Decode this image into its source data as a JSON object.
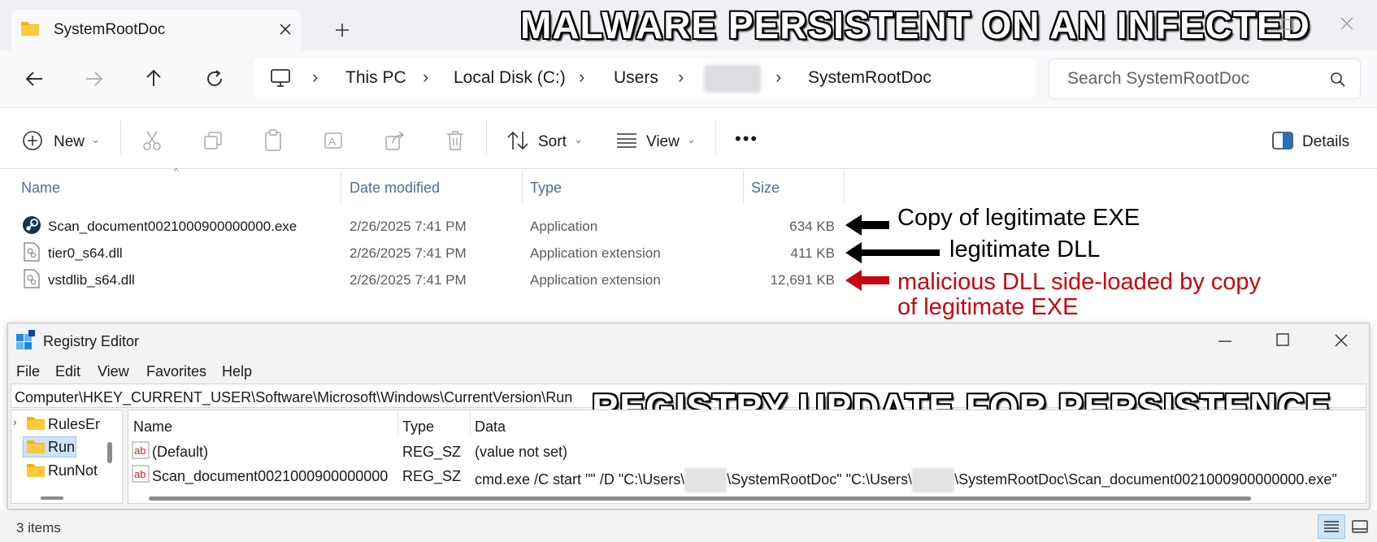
{
  "explorer": {
    "tab_title": "SystemRootDoc",
    "breadcrumb": [
      "This PC",
      "Local Disk (C:)",
      "Users",
      "",
      "SystemRootDoc"
    ],
    "search_placeholder": "Search SystemRootDoc",
    "toolbar": {
      "new": "New",
      "sort": "Sort",
      "view": "View",
      "more": "•••",
      "details": "Details"
    },
    "columns": {
      "name": "Name",
      "date": "Date modified",
      "type": "Type",
      "size": "Size"
    },
    "files": [
      {
        "name": "Scan_document0021000900000000.exe",
        "date": "2/26/2025 7:41 PM",
        "type": "Application",
        "size": "634 KB",
        "icon": "steam-app-icon"
      },
      {
        "name": "tier0_s64.dll",
        "date": "2/26/2025 7:41 PM",
        "type": "Application extension",
        "size": "411 KB",
        "icon": "dll-file-icon"
      },
      {
        "name": "vstdlib_s64.dll",
        "date": "2/26/2025 7:41 PM",
        "type": "Application extension",
        "size": "12,691 KB",
        "icon": "dll-file-icon"
      }
    ],
    "status": "3 items"
  },
  "annotations": {
    "headline_top": "MALWARE PERSISTENT ON AN INFECTED HOST",
    "headline_registry": "REGISTRY UPDATE FOR PERSISTENCE",
    "arrow_1": "Copy of legitimate EXE",
    "arrow_2": "legitimate DLL",
    "arrow_3_line1": "malicious DLL side-loaded by copy",
    "arrow_3_line2": "of legitimate EXE",
    "colors": {
      "black_arrow": "#000000",
      "red_arrow": "#c8050f"
    }
  },
  "registry": {
    "title": "Registry Editor",
    "menu": [
      "File",
      "Edit",
      "View",
      "Favorites",
      "Help"
    ],
    "path": "Computer\\HKEY_CURRENT_USER\\Software\\Microsoft\\Windows\\CurrentVersion\\Run",
    "tree": [
      "RulesEn",
      "Run",
      "RunNot"
    ],
    "columns": {
      "name": "Name",
      "type": "Type",
      "data": "Data"
    },
    "values": [
      {
        "name": "(Default)",
        "type": "REG_SZ",
        "data": "(value not set)"
      },
      {
        "name": "Scan_document0021000900000000",
        "type": "REG_SZ",
        "data_1": "cmd.exe /C start \"\" /D \"C:\\Users\\",
        "data_2": "\\SystemRootDoc\" \"C:\\Users\\",
        "data_3": "\\SystemRootDoc\\Scan_document0021000900000000.exe\""
      }
    ]
  }
}
